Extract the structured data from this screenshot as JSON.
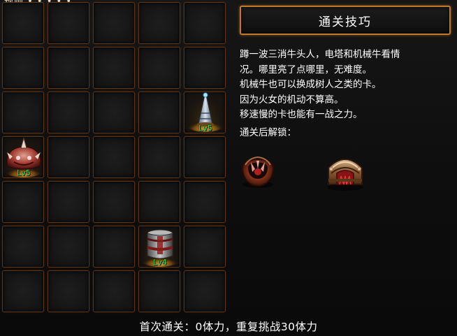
{
  "top_clip_text": "规则  • • • • •",
  "grid": {
    "rows": 7,
    "cols": 5,
    "units": [
      {
        "row": 2,
        "col": 4,
        "icon": "electric-tower-icon",
        "level": "Lv5"
      },
      {
        "row": 3,
        "col": 0,
        "icon": "horned-tauren-icon",
        "level": "Lv5"
      },
      {
        "row": 5,
        "col": 3,
        "icon": "mechanical-drum-icon",
        "level": "Lv4"
      }
    ]
  },
  "tips": {
    "title": "通关技巧",
    "lines": [
      "蹲一波三消牛头人，电塔和机械牛看情",
      "况。哪里亮了点哪里，无难度。",
      "机械牛也可以换成树人之类的卡。",
      "因为火女的机动不算高。",
      "移速慢的卡也能有一战之力。"
    ],
    "unlock_label": "通关后解锁：",
    "unlock_icons": [
      "crescent-claw-icon",
      "mech-shell-icon"
    ]
  },
  "footer": "首次通关：0体力，重复挑战30体力",
  "colors": {
    "cell_border": "#5a3414",
    "header_border": "#c0782a",
    "level_text": "#35e835"
  }
}
